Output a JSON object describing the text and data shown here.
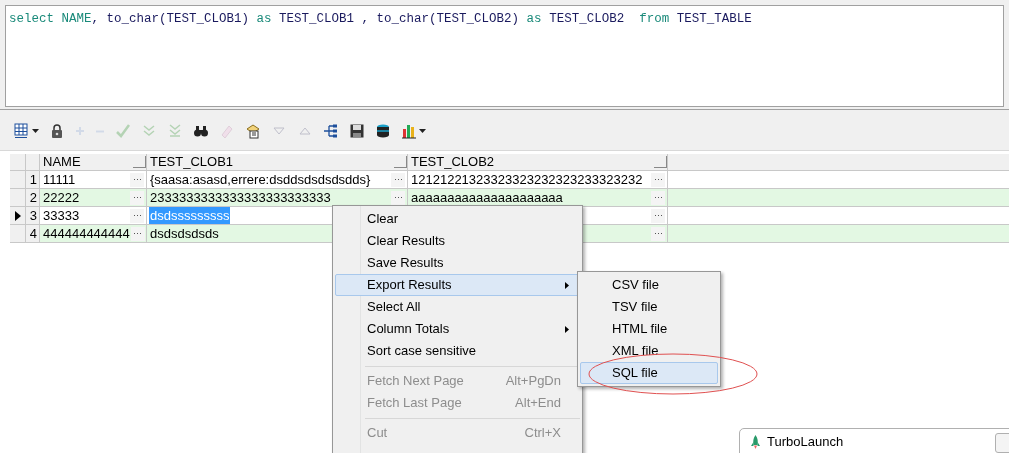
{
  "editor": {
    "tokens": [
      {
        "text": "select NAME",
        "kind": "keyword"
      },
      {
        "text": ", to_char(TEST_CLOB1) ",
        "kind": "plain"
      },
      {
        "text": "as",
        "kind": "keyword"
      },
      {
        "text": " TEST_CLOB1 , to_char(TEST_CLOB2) ",
        "kind": "plain"
      },
      {
        "text": "as",
        "kind": "keyword"
      },
      {
        "text": " TEST_CLOB2  ",
        "kind": "plain"
      },
      {
        "text": "from",
        "kind": "keyword"
      },
      {
        "text": " TEST_TABLE",
        "kind": "plain"
      }
    ]
  },
  "toolbar": [
    {
      "kind": "grid",
      "disabled": false,
      "dropdown": true
    },
    {
      "kind": "lock",
      "disabled": false,
      "dropdown": false
    },
    {
      "kind": "plus",
      "disabled": true,
      "dropdown": false
    },
    {
      "kind": "minus",
      "disabled": true,
      "dropdown": false
    },
    {
      "kind": "check",
      "disabled": true,
      "dropdown": false
    },
    {
      "kind": "down2",
      "disabled": true,
      "dropdown": false
    },
    {
      "kind": "downbar",
      "disabled": true,
      "dropdown": false
    },
    {
      "kind": "binoculars",
      "disabled": false,
      "dropdown": false
    },
    {
      "kind": "eraser",
      "disabled": true,
      "dropdown": false
    },
    {
      "kind": "document",
      "disabled": false,
      "dropdown": false
    },
    {
      "kind": "down",
      "disabled": true,
      "dropdown": false
    },
    {
      "kind": "up",
      "disabled": true,
      "dropdown": false
    },
    {
      "kind": "tree",
      "disabled": false,
      "dropdown": false
    },
    {
      "kind": "save",
      "disabled": false,
      "dropdown": false
    },
    {
      "kind": "database",
      "disabled": false,
      "dropdown": false
    },
    {
      "kind": "chart",
      "disabled": false,
      "dropdown": true
    }
  ],
  "grid": {
    "columns": [
      "NAME",
      "TEST_CLOB1",
      "TEST_CLOB2"
    ],
    "rows": [
      {
        "number": "1",
        "current": false,
        "cells": [
          {
            "text": "11111",
            "selected": false
          },
          {
            "text": "{saasa:asasd,errere:dsddsdsdsdsdds}",
            "selected": false
          },
          {
            "text": "12121221323323323232323233323232",
            "selected": false
          }
        ]
      },
      {
        "number": "2",
        "current": false,
        "cells": [
          {
            "text": "22222",
            "selected": false
          },
          {
            "text": "2333333333333333333333333",
            "selected": false
          },
          {
            "text": "aaaaaaaaaaaaaaaaaaaaa",
            "selected": false
          }
        ]
      },
      {
        "number": "3",
        "current": true,
        "cells": [
          {
            "text": "33333",
            "selected": false
          },
          {
            "text": "dsdsssssssss",
            "selected": true
          },
          {
            "selected": false
          }
        ]
      },
      {
        "number": "4",
        "current": false,
        "cells": [
          {
            "text": "444444444444",
            "selected": false
          },
          {
            "text": "dsdsdsdsds",
            "selected": false
          },
          {
            "selected": false
          }
        ]
      }
    ]
  },
  "context_menu": {
    "items": [
      {
        "kind": "item",
        "label": "Clear",
        "disabled": false,
        "selected": false,
        "submenu": false
      },
      {
        "kind": "item",
        "label": "Clear Results",
        "disabled": false,
        "selected": false,
        "submenu": false
      },
      {
        "kind": "item",
        "label": "Save Results",
        "disabled": false,
        "selected": false,
        "submenu": false
      },
      {
        "kind": "item",
        "label": "Export Results",
        "disabled": false,
        "selected": true,
        "submenu": true
      },
      {
        "kind": "item",
        "label": "Select All",
        "disabled": false,
        "selected": false,
        "submenu": false
      },
      {
        "kind": "item",
        "label": "Column Totals",
        "disabled": false,
        "selected": false,
        "submenu": true
      },
      {
        "kind": "item",
        "label": "Sort case sensitive",
        "disabled": false,
        "selected": false,
        "submenu": false
      },
      {
        "kind": "separator"
      },
      {
        "kind": "item",
        "label": "Fetch Next Page",
        "shortcut": "Alt+PgDn",
        "disabled": true,
        "selected": false,
        "submenu": false
      },
      {
        "kind": "item",
        "label": "Fetch Last Page",
        "shortcut": "Alt+End",
        "disabled": true,
        "selected": false,
        "submenu": false
      },
      {
        "kind": "separator"
      },
      {
        "kind": "item",
        "label": "Cut",
        "shortcut": "Ctrl+X",
        "disabled": true,
        "selected": false,
        "submenu": false
      }
    ]
  },
  "submenu": {
    "items": [
      {
        "label": "CSV file",
        "selected": false,
        "circled": false
      },
      {
        "label": "TSV file",
        "selected": false,
        "circled": false
      },
      {
        "label": "HTML file",
        "selected": false,
        "circled": false
      },
      {
        "label": "XML file",
        "selected": false,
        "circled": false
      },
      {
        "label": "SQL file",
        "selected": true,
        "circled": true
      }
    ]
  },
  "taskbar_window": {
    "title": "TurboLaunch"
  }
}
